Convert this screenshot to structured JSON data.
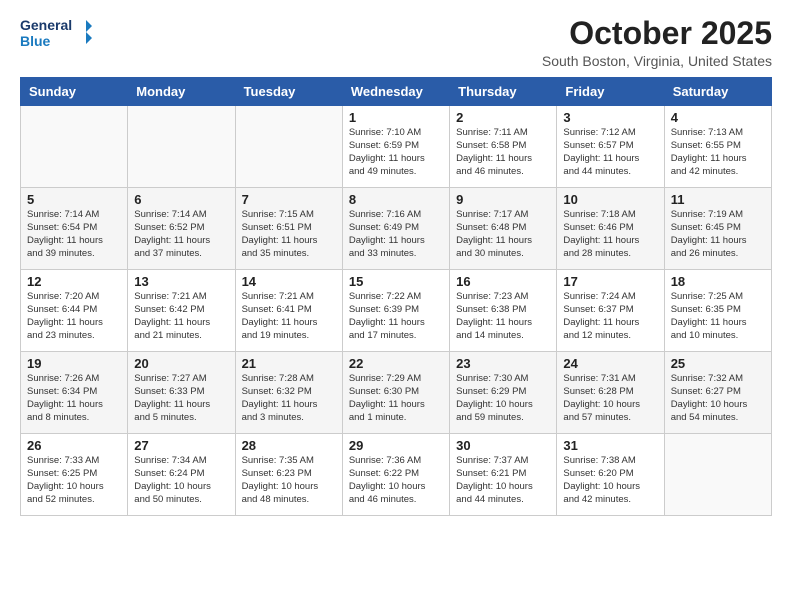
{
  "header": {
    "logo_line1": "General",
    "logo_line2": "Blue",
    "month": "October 2025",
    "location": "South Boston, Virginia, United States"
  },
  "weekdays": [
    "Sunday",
    "Monday",
    "Tuesday",
    "Wednesday",
    "Thursday",
    "Friday",
    "Saturday"
  ],
  "weeks": [
    [
      {
        "day": "",
        "info": ""
      },
      {
        "day": "",
        "info": ""
      },
      {
        "day": "",
        "info": ""
      },
      {
        "day": "1",
        "info": "Sunrise: 7:10 AM\nSunset: 6:59 PM\nDaylight: 11 hours and 49 minutes."
      },
      {
        "day": "2",
        "info": "Sunrise: 7:11 AM\nSunset: 6:58 PM\nDaylight: 11 hours and 46 minutes."
      },
      {
        "day": "3",
        "info": "Sunrise: 7:12 AM\nSunset: 6:57 PM\nDaylight: 11 hours and 44 minutes."
      },
      {
        "day": "4",
        "info": "Sunrise: 7:13 AM\nSunset: 6:55 PM\nDaylight: 11 hours and 42 minutes."
      }
    ],
    [
      {
        "day": "5",
        "info": "Sunrise: 7:14 AM\nSunset: 6:54 PM\nDaylight: 11 hours and 39 minutes."
      },
      {
        "day": "6",
        "info": "Sunrise: 7:14 AM\nSunset: 6:52 PM\nDaylight: 11 hours and 37 minutes."
      },
      {
        "day": "7",
        "info": "Sunrise: 7:15 AM\nSunset: 6:51 PM\nDaylight: 11 hours and 35 minutes."
      },
      {
        "day": "8",
        "info": "Sunrise: 7:16 AM\nSunset: 6:49 PM\nDaylight: 11 hours and 33 minutes."
      },
      {
        "day": "9",
        "info": "Sunrise: 7:17 AM\nSunset: 6:48 PM\nDaylight: 11 hours and 30 minutes."
      },
      {
        "day": "10",
        "info": "Sunrise: 7:18 AM\nSunset: 6:46 PM\nDaylight: 11 hours and 28 minutes."
      },
      {
        "day": "11",
        "info": "Sunrise: 7:19 AM\nSunset: 6:45 PM\nDaylight: 11 hours and 26 minutes."
      }
    ],
    [
      {
        "day": "12",
        "info": "Sunrise: 7:20 AM\nSunset: 6:44 PM\nDaylight: 11 hours and 23 minutes."
      },
      {
        "day": "13",
        "info": "Sunrise: 7:21 AM\nSunset: 6:42 PM\nDaylight: 11 hours and 21 minutes."
      },
      {
        "day": "14",
        "info": "Sunrise: 7:21 AM\nSunset: 6:41 PM\nDaylight: 11 hours and 19 minutes."
      },
      {
        "day": "15",
        "info": "Sunrise: 7:22 AM\nSunset: 6:39 PM\nDaylight: 11 hours and 17 minutes."
      },
      {
        "day": "16",
        "info": "Sunrise: 7:23 AM\nSunset: 6:38 PM\nDaylight: 11 hours and 14 minutes."
      },
      {
        "day": "17",
        "info": "Sunrise: 7:24 AM\nSunset: 6:37 PM\nDaylight: 11 hours and 12 minutes."
      },
      {
        "day": "18",
        "info": "Sunrise: 7:25 AM\nSunset: 6:35 PM\nDaylight: 11 hours and 10 minutes."
      }
    ],
    [
      {
        "day": "19",
        "info": "Sunrise: 7:26 AM\nSunset: 6:34 PM\nDaylight: 11 hours and 8 minutes."
      },
      {
        "day": "20",
        "info": "Sunrise: 7:27 AM\nSunset: 6:33 PM\nDaylight: 11 hours and 5 minutes."
      },
      {
        "day": "21",
        "info": "Sunrise: 7:28 AM\nSunset: 6:32 PM\nDaylight: 11 hours and 3 minutes."
      },
      {
        "day": "22",
        "info": "Sunrise: 7:29 AM\nSunset: 6:30 PM\nDaylight: 11 hours and 1 minute."
      },
      {
        "day": "23",
        "info": "Sunrise: 7:30 AM\nSunset: 6:29 PM\nDaylight: 10 hours and 59 minutes."
      },
      {
        "day": "24",
        "info": "Sunrise: 7:31 AM\nSunset: 6:28 PM\nDaylight: 10 hours and 57 minutes."
      },
      {
        "day": "25",
        "info": "Sunrise: 7:32 AM\nSunset: 6:27 PM\nDaylight: 10 hours and 54 minutes."
      }
    ],
    [
      {
        "day": "26",
        "info": "Sunrise: 7:33 AM\nSunset: 6:25 PM\nDaylight: 10 hours and 52 minutes."
      },
      {
        "day": "27",
        "info": "Sunrise: 7:34 AM\nSunset: 6:24 PM\nDaylight: 10 hours and 50 minutes."
      },
      {
        "day": "28",
        "info": "Sunrise: 7:35 AM\nSunset: 6:23 PM\nDaylight: 10 hours and 48 minutes."
      },
      {
        "day": "29",
        "info": "Sunrise: 7:36 AM\nSunset: 6:22 PM\nDaylight: 10 hours and 46 minutes."
      },
      {
        "day": "30",
        "info": "Sunrise: 7:37 AM\nSunset: 6:21 PM\nDaylight: 10 hours and 44 minutes."
      },
      {
        "day": "31",
        "info": "Sunrise: 7:38 AM\nSunset: 6:20 PM\nDaylight: 10 hours and 42 minutes."
      },
      {
        "day": "",
        "info": ""
      }
    ]
  ]
}
